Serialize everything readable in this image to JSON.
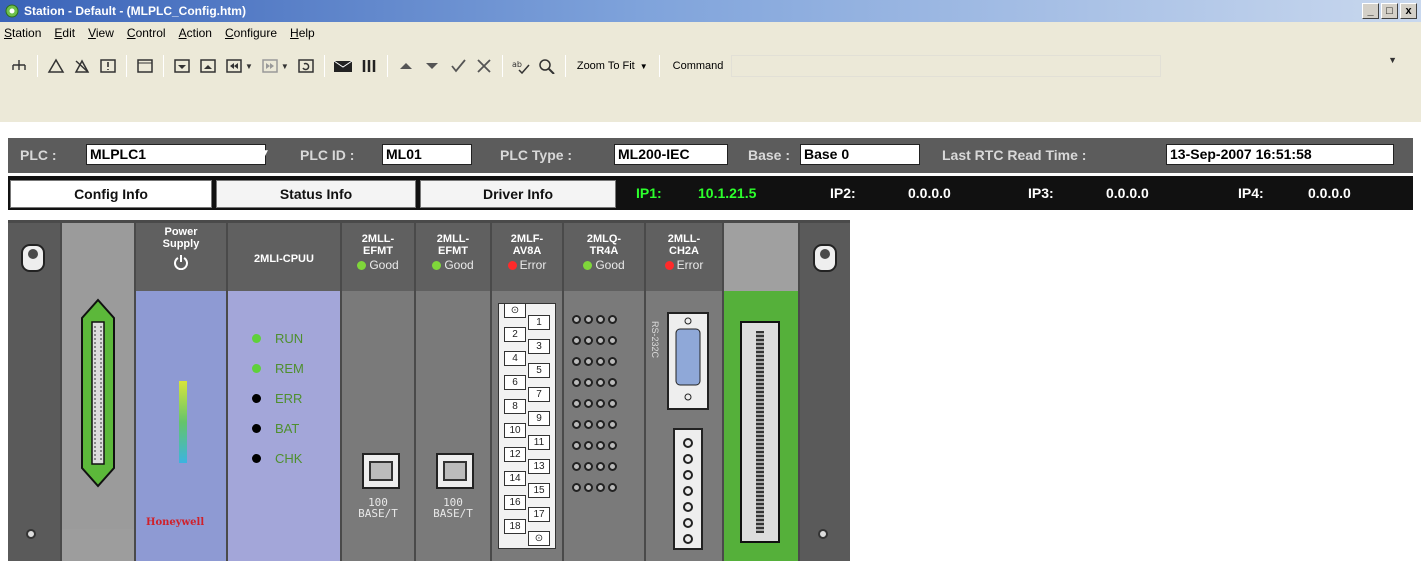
{
  "window": {
    "title": "Station - Default - (MLPLC_Config.htm)",
    "controls": [
      "_",
      "□",
      "x"
    ]
  },
  "menu": [
    "Station",
    "Edit",
    "View",
    "Control",
    "Action",
    "Configure",
    "Help"
  ],
  "toolbar": {
    "zoom_label": "Zoom To Fit",
    "command_label": "Command",
    "command_value": ""
  },
  "plc": {
    "plc_label": "PLC :",
    "plc_value": "MLPLC1",
    "plc_id_label": "PLC ID :",
    "plc_id_value": "ML01",
    "plc_type_label": "PLC Type :",
    "plc_type_value": "ML200-IEC",
    "base_label": "Base :",
    "base_value": "Base 0",
    "rtc_label": "Last RTC Read Time :",
    "rtc_value": "13-Sep-2007 16:51:58"
  },
  "tabs": [
    "Config Info",
    "Status Info",
    "Driver Info"
  ],
  "ips": [
    {
      "label": "IP1:",
      "value": "10.1.21.5"
    },
    {
      "label": "IP2:",
      "value": "0.0.0.0"
    },
    {
      "label": "IP3:",
      "value": "0.0.0.0"
    },
    {
      "label": "IP4:",
      "value": "0.0.0.0"
    }
  ],
  "rack": {
    "power": {
      "title1": "Power",
      "title2": "Supply",
      "brand": "Honeywell"
    },
    "cpu": {
      "title": "2MLI-CPUU",
      "leds": [
        {
          "label": "RUN",
          "color": "#5fd13a"
        },
        {
          "label": "REM",
          "color": "#5fd13a"
        },
        {
          "label": "ERR",
          "color": "#000000"
        },
        {
          "label": "BAT",
          "color": "#000000"
        },
        {
          "label": "CHK",
          "color": "#000000"
        }
      ]
    },
    "modules": [
      {
        "l1": "2MLL-",
        "l2": "EFMT",
        "status": "Good",
        "base1": "100",
        "base2": "BASE/T"
      },
      {
        "l1": "2MLL-",
        "l2": "EFMT",
        "status": "Good",
        "base1": "100",
        "base2": "BASE/T"
      },
      {
        "l1": "2MLF-",
        "l2": "AV8A",
        "status": "Error"
      },
      {
        "l1": "2MLQ-",
        "l2": "TR4A",
        "status": "Good"
      },
      {
        "l1": "2MLL-",
        "l2": "CH2A",
        "status": "Error",
        "port": "RS-232C"
      }
    ],
    "terminals_left": [
      "⊙",
      "2",
      "4",
      "6",
      "8",
      "10",
      "12",
      "14",
      "16",
      "18"
    ],
    "terminals_right": [
      "1",
      "3",
      "5",
      "7",
      "9",
      "11",
      "13",
      "15",
      "17",
      "⊙"
    ]
  }
}
